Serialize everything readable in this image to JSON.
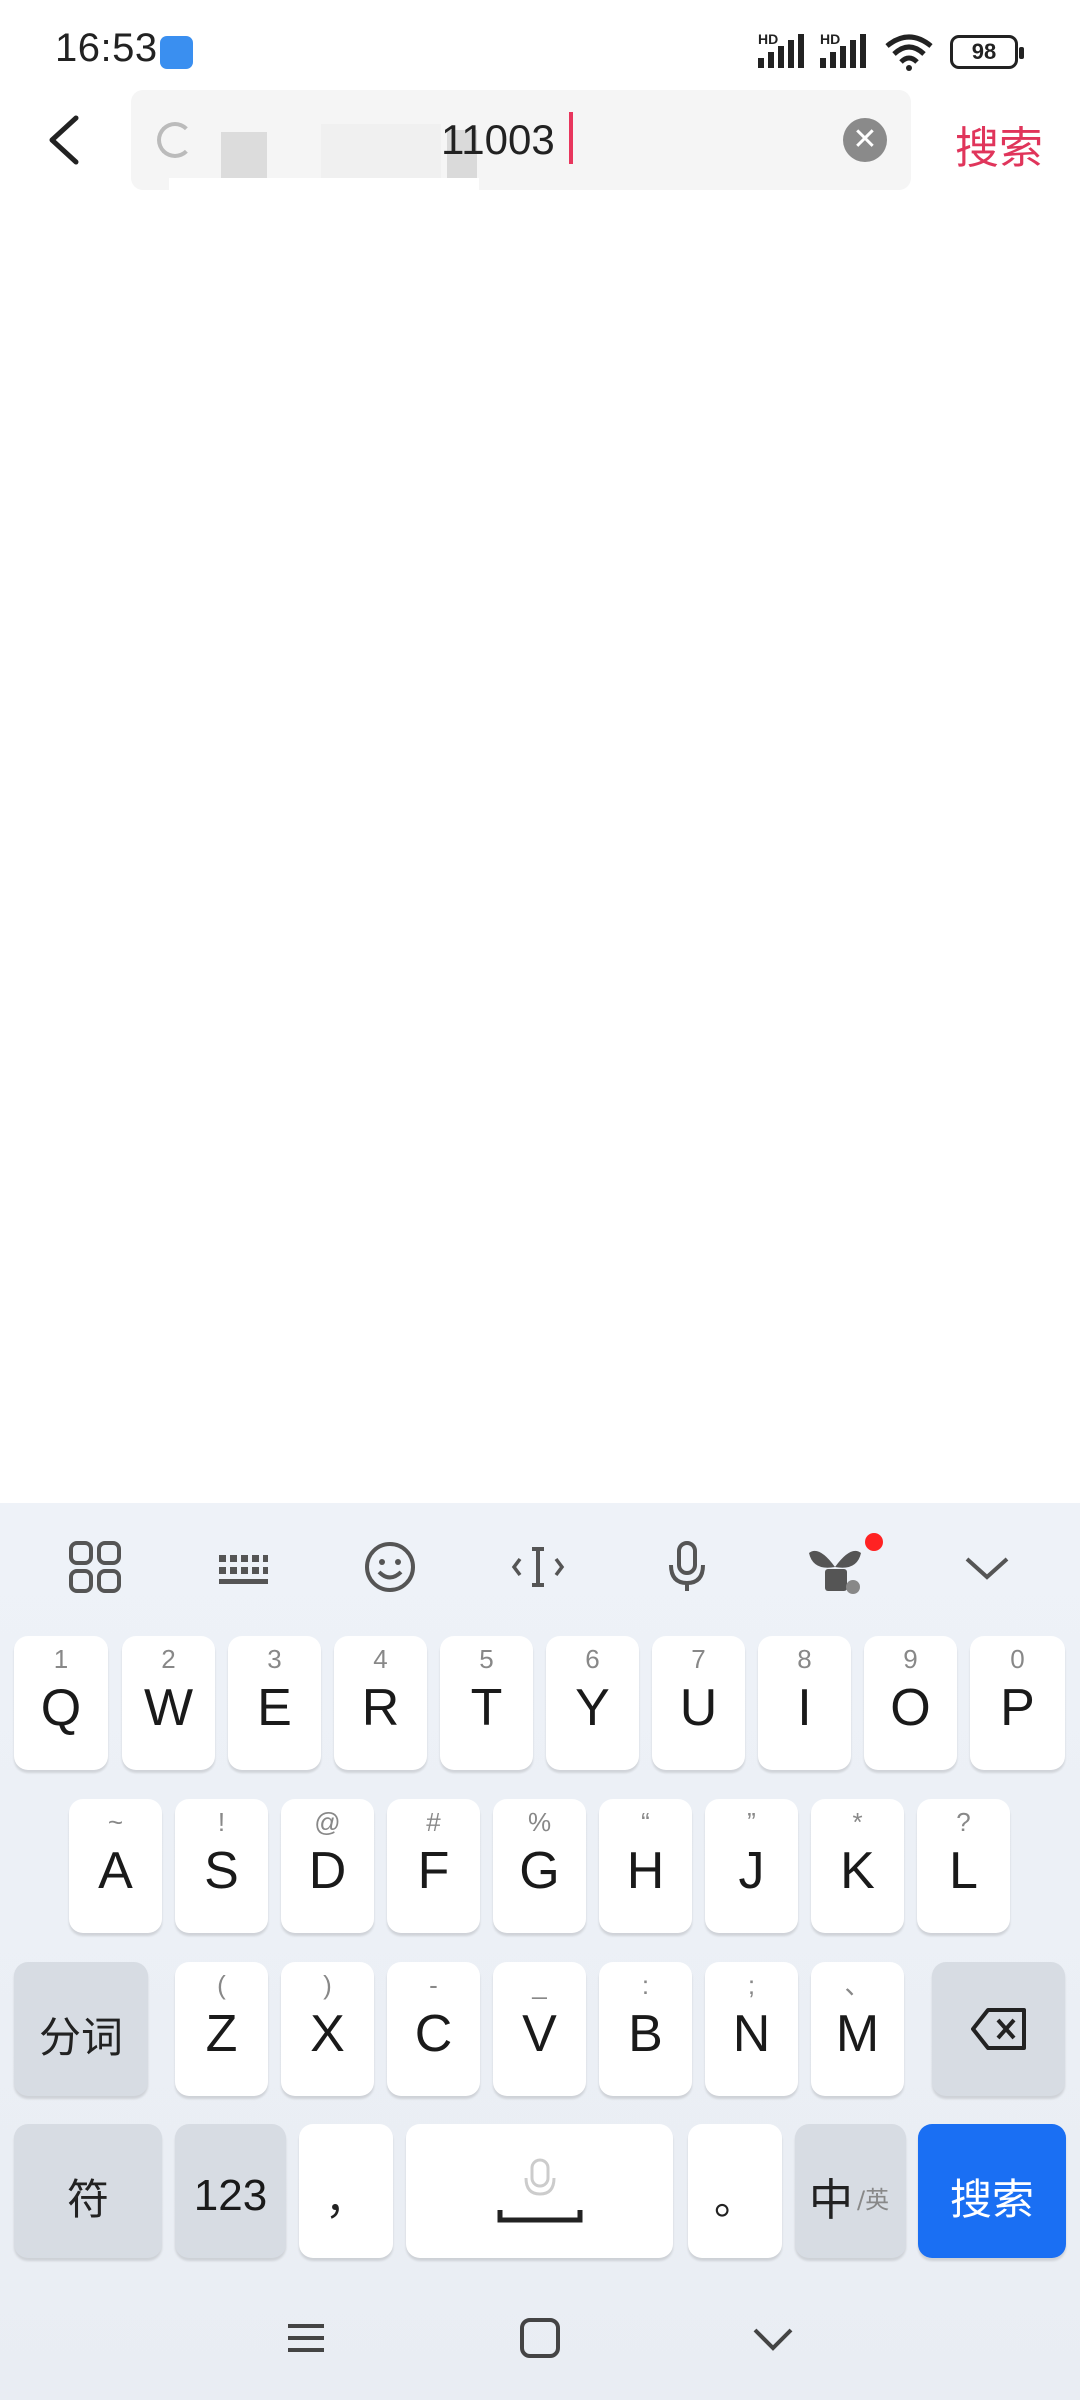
{
  "status_bar": {
    "time": "16:53",
    "network1": "HD",
    "network2": "HD",
    "battery": "98"
  },
  "search": {
    "query_visible": "11003",
    "search_button_label": "搜索"
  },
  "keyboard": {
    "row1": [
      {
        "key": "Q",
        "sub": "1"
      },
      {
        "key": "W",
        "sub": "2"
      },
      {
        "key": "E",
        "sub": "3"
      },
      {
        "key": "R",
        "sub": "4"
      },
      {
        "key": "T",
        "sub": "5"
      },
      {
        "key": "Y",
        "sub": "6"
      },
      {
        "key": "U",
        "sub": "7"
      },
      {
        "key": "I",
        "sub": "8"
      },
      {
        "key": "O",
        "sub": "9"
      },
      {
        "key": "P",
        "sub": "0"
      }
    ],
    "row2": [
      {
        "key": "A",
        "sub": "~"
      },
      {
        "key": "S",
        "sub": "!"
      },
      {
        "key": "D",
        "sub": "@"
      },
      {
        "key": "F",
        "sub": "#"
      },
      {
        "key": "G",
        "sub": "%"
      },
      {
        "key": "H",
        "sub": "“"
      },
      {
        "key": "J",
        "sub": "”"
      },
      {
        "key": "K",
        "sub": "*"
      },
      {
        "key": "L",
        "sub": "?"
      }
    ],
    "row3": [
      {
        "key": "Z",
        "sub": "("
      },
      {
        "key": "X",
        "sub": ")"
      },
      {
        "key": "C",
        "sub": "-"
      },
      {
        "key": "V",
        "sub": "_"
      },
      {
        "key": "B",
        "sub": ":"
      },
      {
        "key": "N",
        "sub": ";"
      },
      {
        "key": "M",
        "sub": "、"
      }
    ],
    "fenci_label": "分词",
    "fu_label": "符",
    "num_label": "123",
    "comma_label": "，",
    "period_label": "。",
    "zh_label": "中",
    "en_label": "/英",
    "enter_label": "搜索"
  },
  "colors": {
    "accent_red": "#e0355b",
    "enter_blue": "#1a6ff3"
  }
}
